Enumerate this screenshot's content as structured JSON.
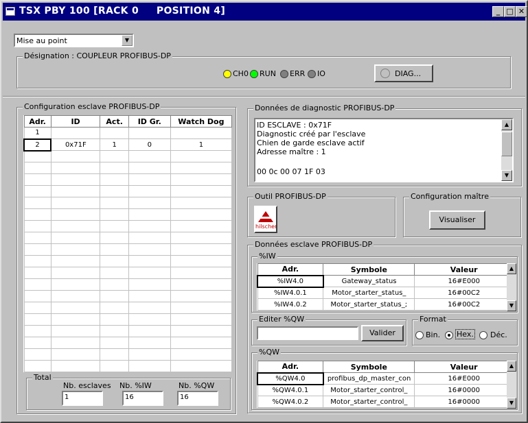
{
  "window": {
    "title": "TSX PBY 100 [RACK 0     POSITION 4]"
  },
  "mode_select": {
    "value": "Mise au point"
  },
  "designation": {
    "label": "Désignation : COUPLEUR PROFIBUS-DP"
  },
  "leds": [
    {
      "label": "CH0",
      "color": "#ffff00"
    },
    {
      "label": "RUN",
      "color": "#00ff00"
    },
    {
      "label": "ERR",
      "color": "#808080"
    },
    {
      "label": "IO",
      "color": "#808080"
    }
  ],
  "diag_button": {
    "label": "DIAG..."
  },
  "slave_config": {
    "title": "Configuration esclave PROFIBUS-DP",
    "headers": [
      "Adr.",
      "ID",
      "Act.",
      "ID Gr.",
      "Watch Dog"
    ],
    "rows": [
      [
        "1",
        "",
        "",
        "",
        ""
      ],
      [
        "2",
        "0x71F",
        "1",
        "0",
        "1"
      ]
    ],
    "empty_rows": 19
  },
  "totals": {
    "title": "Total",
    "slaves_label": "Nb. esclaves",
    "slaves_value": "1",
    "iw_label": "Nb. %IW",
    "iw_value": "16",
    "qw_label": "Nb. %QW",
    "qw_value": "16"
  },
  "diagnostic": {
    "title": "Données de diagnostic PROFIBUS-DP",
    "lines": [
      "ID ESCLAVE : 0x71F",
      "Diagnostic créé par l'esclave",
      "Chien de garde esclave actif",
      "Adresse maître : 1",
      "00 0c 00 07 1F 03"
    ]
  },
  "tool": {
    "title": "Outil PROFIBUS-DP",
    "logo_text": "hilscher"
  },
  "master_config": {
    "title": "Configuration maître",
    "button": "Visualiser"
  },
  "slave_data": {
    "title": "Données esclave PROFIBUS-DP",
    "iw_group": "%IW",
    "iw_headers": [
      "Adr.",
      "Symbole",
      "Valeur"
    ],
    "iw_rows": [
      [
        "%IW4.0",
        "Gateway_status",
        "16#E000"
      ],
      [
        "%IW4.0.1",
        "Motor_starter_status_",
        "16#00C2"
      ],
      [
        "%IW4.0.2",
        "Motor_starter_status_;",
        "16#00C2"
      ]
    ],
    "edit_qw": {
      "title": "Editer %QW",
      "value": "",
      "button": "Valider"
    },
    "format": {
      "title": "Format",
      "options": [
        "Bin.",
        "Hex.",
        "Déc."
      ],
      "selected": "Hex."
    },
    "qw_group": "%QW",
    "qw_headers": [
      "Adr.",
      "Symbole",
      "Valeur"
    ],
    "qw_rows": [
      [
        "%QW4.0",
        "profibus_dp_master_con",
        "16#E000"
      ],
      [
        "%QW4.0.1",
        "Motor_starter_control_",
        "16#0000"
      ],
      [
        "%QW4.0.2",
        "Motor_starter_control_",
        "16#0000"
      ]
    ]
  }
}
